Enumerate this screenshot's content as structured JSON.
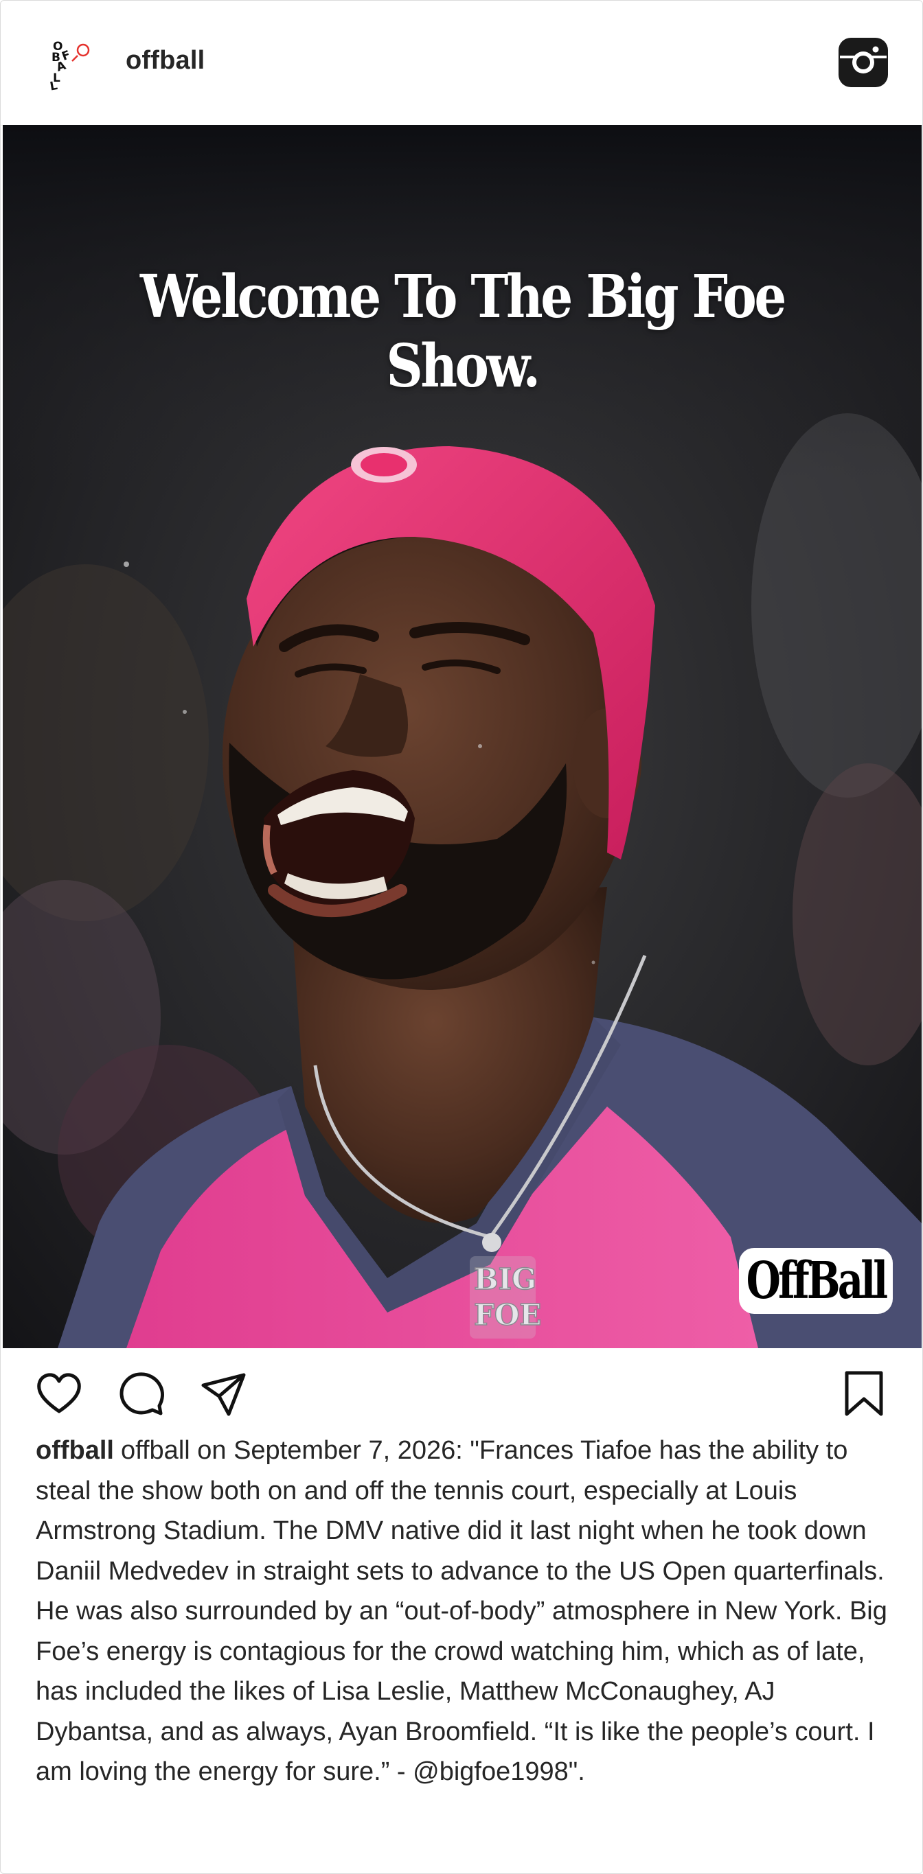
{
  "header": {
    "username": "offball",
    "avatar_icon": "offball-logo-icon",
    "app_icon": "instagram-icon"
  },
  "photo": {
    "headline": "Welcome To The Big Foe Show.",
    "watermark": "OffBall",
    "pendant_text": "BIG FOE",
    "headband_color": "#e8306e",
    "shirt_color": "#e54a9a",
    "shirt_sleeve_color": "#4a4e72"
  },
  "actions": {
    "icons": [
      "heart-icon",
      "comment-icon",
      "share-icon",
      "bookmark-icon"
    ]
  },
  "caption": {
    "username": "offball",
    "text": "offball on September 7, 2026: \"Frances Tiafoe has the ability to steal the show both on and off the tennis court, especially at Louis Armstrong Stadium. The DMV native did it last night when he took down Daniil Medvedev in straight sets to advance to the US Open quarterfinals. He was also surrounded by an “out-of-body” atmosphere in New York. Big Foe’s energy is contagious for the crowd watching him, which as of late, has included the likes of Lisa Leslie, Matthew McConaughey, AJ Dybantsa, and as always, Ayan Broomfield. “It is like the people’s court. I am loving the energy for sure.” - @bigfoe1998\"."
  }
}
